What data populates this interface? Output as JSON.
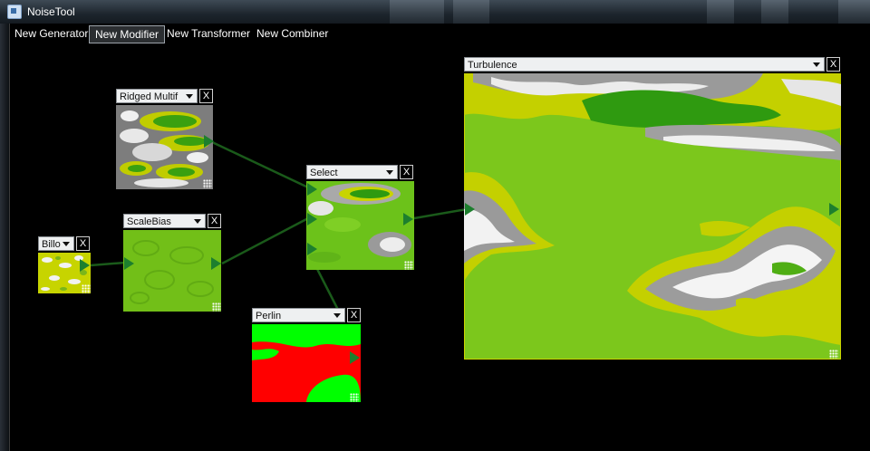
{
  "window": {
    "title": "NoiseTool"
  },
  "menu": [
    {
      "label": "New Generator"
    },
    {
      "label": "New Modifier"
    },
    {
      "label": "New Transformer"
    },
    {
      "label": "New Combiner"
    }
  ],
  "nodes": {
    "ridged": {
      "selected": "Ridged Multif",
      "close": "X"
    },
    "scalebias": {
      "selected": "ScaleBias",
      "close": "X"
    },
    "billow": {
      "selected": "Billo",
      "close": "X"
    },
    "select": {
      "selected": "Select",
      "close": "X"
    },
    "perlin": {
      "selected": "Perlin",
      "close": "X"
    },
    "turbulence": {
      "selected": "Turbulence",
      "close": "X"
    }
  },
  "colors": {
    "wire": "#1a5a1a",
    "port": "#1d7f2e",
    "green": "#6cc21a",
    "yellow": "#d9e000",
    "red": "#ff0000",
    "lime": "#00ff00"
  }
}
